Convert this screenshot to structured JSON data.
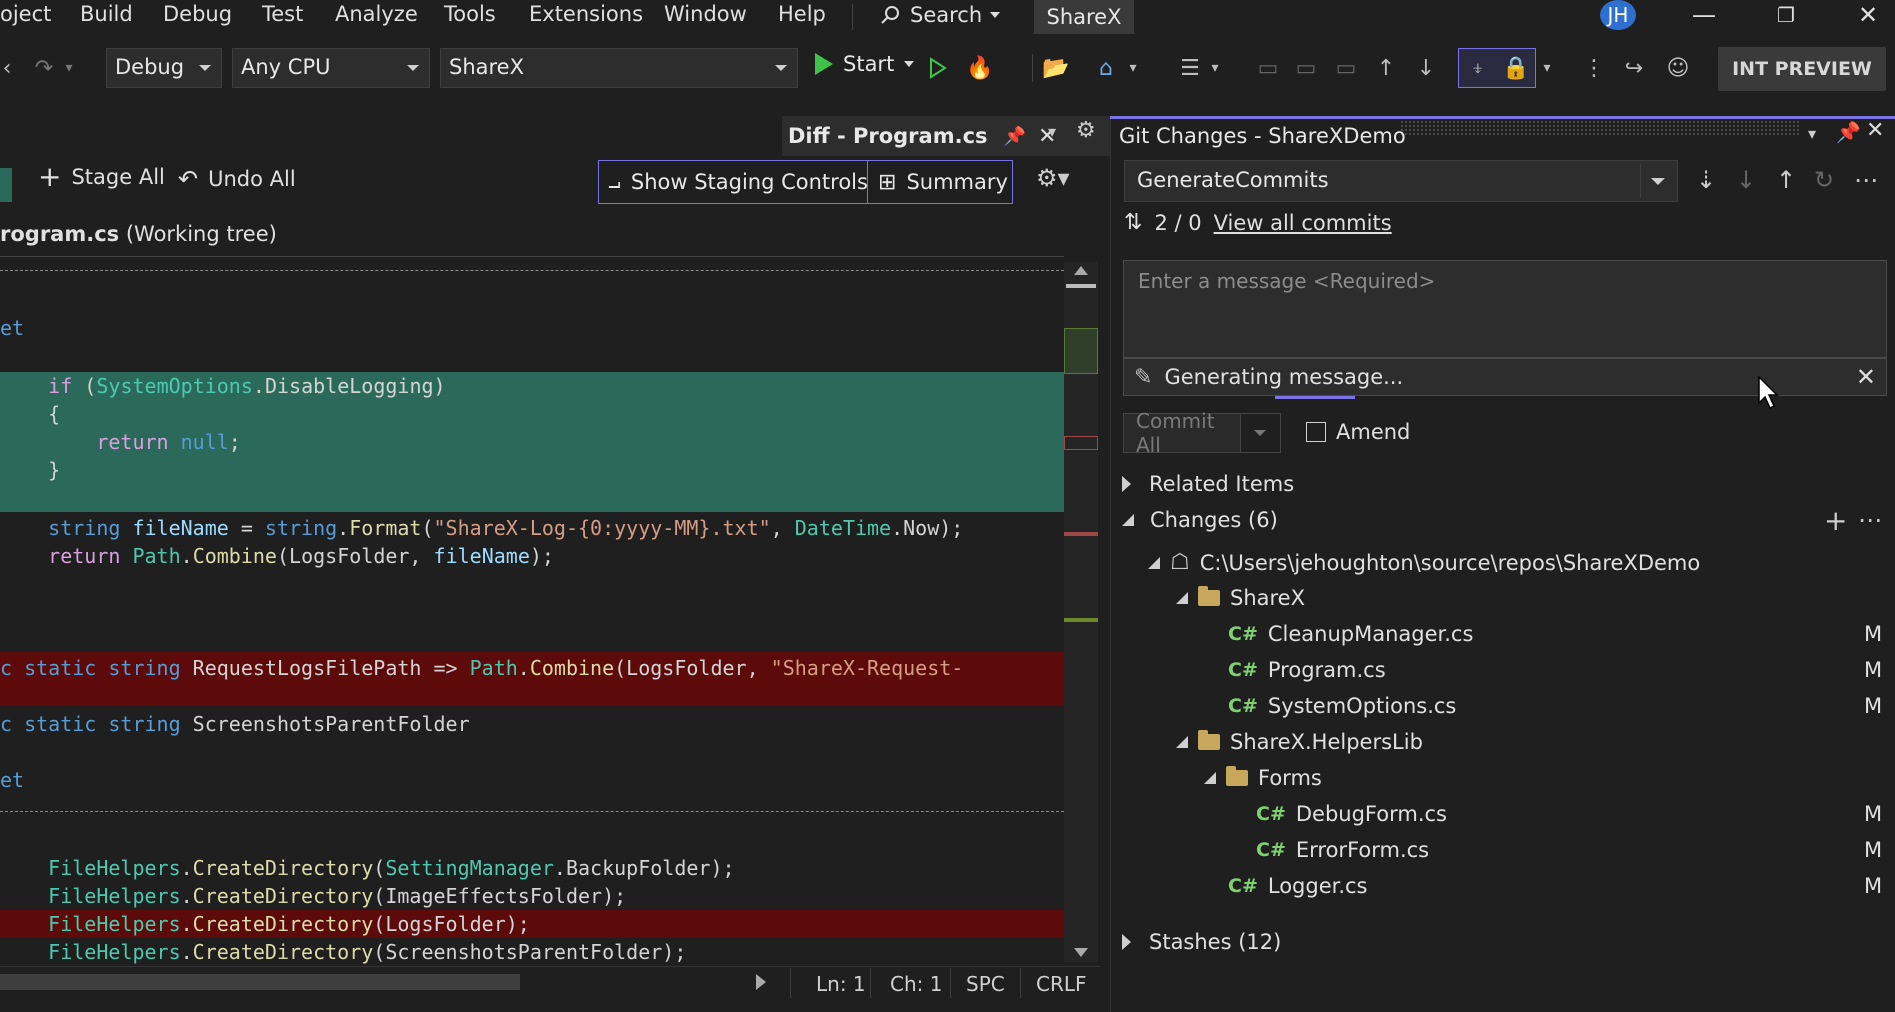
{
  "menu": {
    "items": [
      "oject",
      "Build",
      "Debug",
      "Test",
      "Analyze",
      "Tools",
      "Extensions",
      "Window",
      "Help"
    ],
    "search_label": "Search",
    "solution_tab": "ShareX",
    "avatar_initials": "JH"
  },
  "toolbar": {
    "config": "Debug",
    "platform": "Any CPU",
    "startup_project": "ShareX",
    "start_label": "Start",
    "preview_badge": "INT PREVIEW"
  },
  "diff": {
    "tab_title": "Diff - Program.cs",
    "stage_all": "Stage All",
    "undo_all": "Undo All",
    "show_staging": "Show Staging Controls",
    "summary": "Summary",
    "file_name": "rogram.cs",
    "file_state": "(Working tree)"
  },
  "code": {
    "l1": "et",
    "l2_kw": "if",
    "l2_a": " (",
    "l2_ty": "SystemOptions",
    "l2_b": ".DisableLogging)",
    "l3": "{",
    "l4_kw": "return",
    "l4_v": "null",
    "l4_end": ";",
    "l5": "}",
    "l6_t1": "string",
    "l6_v": "fileName",
    "l6_eq": " = ",
    "l6_t2": "string",
    "l6_dot": ".",
    "l6_fn": "Format",
    "l6_paren": "(",
    "l6_str": "\"ShareX-Log-{0:yyyy-MM}.txt\"",
    "l6_comma": ", ",
    "l6_ty": "DateTime",
    "l6_end": ".Now);",
    "l7_kw": "return",
    "l7_ty": "Path",
    "l7_dot": ".",
    "l7_fn": "Combine",
    "l7_open": "(LogsFolder, ",
    "l7_v": "fileName",
    "l7_end": ");",
    "l8_kw": "c static string",
    "l8_name": " RequestLogsFilePath => ",
    "l8_ty": "Path",
    "l8_dot": ".",
    "l8_fn": "Combine",
    "l8_open": "(LogsFolder, ",
    "l8_str": "\"ShareX-Request-",
    "l9_kw": "c static string",
    "l9_name": " ScreenshotsParentFolder",
    "l10": "et",
    "l11_ty": "FileHelpers",
    "l11_dot": ".",
    "l11_fn": "CreateDirectory",
    "l11_open": "(",
    "l11_ty2": "SettingManager",
    "l11_end": ".BackupFolder);",
    "l12_ty": "FileHelpers",
    "l12_dot": ".",
    "l12_fn": "CreateDirectory",
    "l12_end": "(ImageEffectsFolder);",
    "l13_ty": "FileHelpers",
    "l13_dot": ".",
    "l13_fn": "CreateDirectory",
    "l13_end": "(LogsFolder);",
    "l14_ty": "FileHelpers",
    "l14_dot": ".",
    "l14_fn": "CreateDirectory",
    "l14_end": "(ScreenshotsParentFolder);"
  },
  "status": {
    "line": "Ln: 1",
    "col": "Ch: 1",
    "spacing": "SPC",
    "eol": "CRLF"
  },
  "git": {
    "title": "Git Changes - ShareXDemo",
    "branch": "GenerateCommits",
    "commit_counts": "2 / 0",
    "view_all_commits": "View all commits",
    "message_placeholder": "Enter a message <Required>",
    "generating": "Generating message...",
    "commit_all": "Commit All",
    "amend": "Amend",
    "related_items": "Related Items",
    "changes": "Changes (6)",
    "repo_path": "C:\\Users\\jehoughton\\source\\repos\\ShareXDemo",
    "folder_sharex": "ShareX",
    "file_cleanup": "CleanupManager.cs",
    "file_program": "Program.cs",
    "file_sysoptions": "SystemOptions.cs",
    "folder_helpers": "ShareX.HelpersLib",
    "folder_forms": "Forms",
    "file_debugform": "DebugForm.cs",
    "file_errorform": "ErrorForm.cs",
    "file_logger": "Logger.cs",
    "stashes": "Stashes (12)",
    "status_modified": "M",
    "csharp_glyph": "C#"
  },
  "colors": {
    "accent": "#7a73e6",
    "added_bg": "#2b6a5a",
    "removed_bg": "#5c0a0a",
    "start_green": "#3ec44a"
  }
}
